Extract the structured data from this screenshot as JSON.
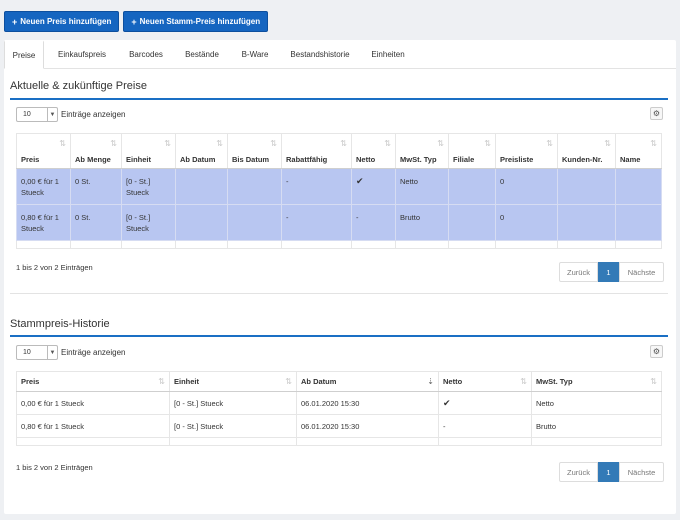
{
  "toolbar": {
    "add_price_label": "Neuen Preis hinzufügen",
    "add_master_price_label": "Neuen Stamm-Preis hinzufügen"
  },
  "tabs": [
    {
      "label": "Preise",
      "active": true
    },
    {
      "label": "Einkaufspreis"
    },
    {
      "label": "Barcodes"
    },
    {
      "label": "Bestände"
    },
    {
      "label": "B-Ware"
    },
    {
      "label": "Bestandshistorie"
    },
    {
      "label": "Einheiten"
    }
  ],
  "section1": {
    "title": "Aktuelle & zukünftige Preise",
    "length_value": "10",
    "length_label": "Einträge anzeigen",
    "headers": [
      "Preis",
      "Ab Menge",
      "Einheit",
      "Ab Datum",
      "Bis Datum",
      "Rabattfähig",
      "Netto",
      "MwSt. Typ",
      "Filiale",
      "Preisliste",
      "Kunden-Nr.",
      "Name"
    ],
    "rows": [
      {
        "preis": "0,00 € für 1 Stueck",
        "ab_menge": "0 St.",
        "einheit": "[0 - St.] Stueck",
        "ab_datum": "",
        "bis_datum": "",
        "rabatt": "-",
        "netto": "✔",
        "mwst": "Netto",
        "filiale": "",
        "preisliste": "0",
        "kunden": "",
        "name": ""
      },
      {
        "preis": "0,80 € für 1 Stueck",
        "ab_menge": "0 St.",
        "einheit": "[0 - St.] Stueck",
        "ab_datum": "",
        "bis_datum": "",
        "rabatt": "-",
        "netto": "-",
        "mwst": "Brutto",
        "filiale": "",
        "preisliste": "0",
        "kunden": "",
        "name": ""
      }
    ],
    "info": "1 bis 2 von 2 Einträgen",
    "pager": {
      "prev": "Zurück",
      "current": "1",
      "next": "Nächste"
    }
  },
  "section2": {
    "title": "Stammpreis-Historie",
    "length_value": "10",
    "length_label": "Einträge anzeigen",
    "headers": [
      "Preis",
      "Einheit",
      "Ab Datum",
      "Netto",
      "MwSt. Typ"
    ],
    "rows": [
      {
        "preis": "0,00 € für 1 Stueck",
        "einheit": "[0 - St.] Stueck",
        "ab_datum": "06.01.2020 15:30",
        "netto": "✔",
        "mwst": "Netto"
      },
      {
        "preis": "0,80 € für 1 Stueck",
        "einheit": "[0 - St.] Stueck",
        "ab_datum": "06.01.2020 15:30",
        "netto": "-",
        "mwst": "Brutto"
      }
    ],
    "info": "1 bis 2 von 2 Einträgen",
    "pager": {
      "prev": "Zurück",
      "current": "1",
      "next": "Nächste"
    }
  },
  "icons": {
    "add": "plus-icon",
    "settings": "gears-icon",
    "sort": "sort-icon",
    "check": "check-icon"
  }
}
